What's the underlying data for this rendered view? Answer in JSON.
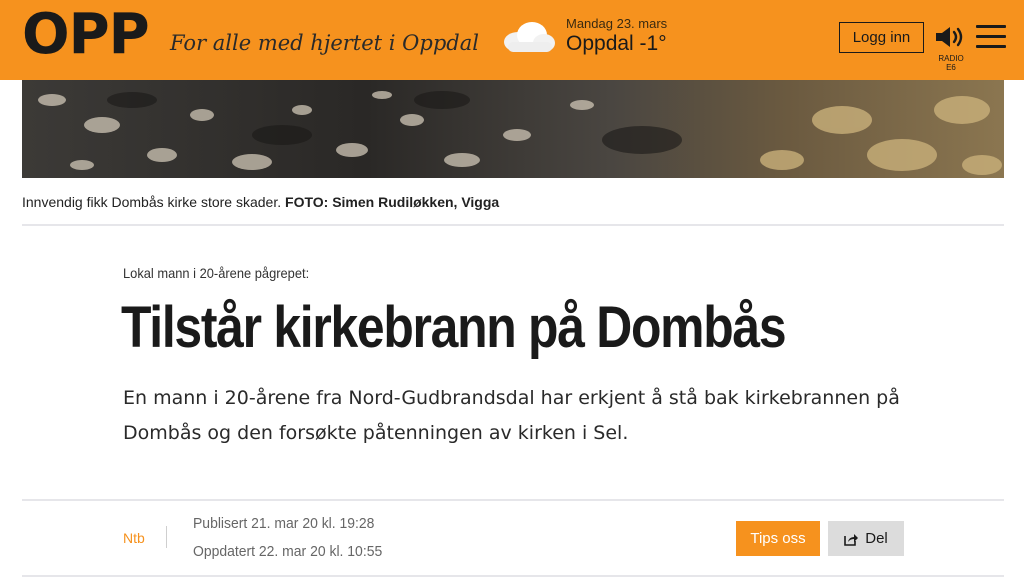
{
  "header": {
    "logo": "OPP",
    "slogan": "For alle med hjertet i Oppdal",
    "weather": {
      "icon": "cloud-icon",
      "day": "Mandag 23. mars",
      "location_temp": "Oppdal -1°"
    },
    "login_label": "Logg inn",
    "radio": {
      "icon": "speaker-icon",
      "label": "RADIO E6"
    },
    "menu_icon": "hamburger-menu-icon"
  },
  "photo": {
    "caption": "Innvendig fikk Dombås kirke store skader.",
    "credit": "FOTO: Simen Rudiløkken, Vigga"
  },
  "article": {
    "kicker": "Lokal mann i 20-årene pågrepet:",
    "title": "Tilstår kirkebrann på Dombås",
    "lead": "En mann i 20-årene fra Nord-Gudbrandsdal har erkjent å stå bak kirkebrannen på Dombås og den forsøkte påtenningen av kirken i Sel."
  },
  "meta": {
    "author": "Ntb",
    "published": "Publisert 21. mar 20 kl. 19:28",
    "updated": "Oppdatert 22. mar 20 kl. 10:55",
    "tips_label": "Tips oss",
    "share_label": "Del",
    "share_icon": "share-icon"
  },
  "colors": {
    "brand": "#f6921e",
    "text": "#1a1a1a",
    "divider": "#e6e6ea",
    "share_bg": "#dcdcdc"
  }
}
